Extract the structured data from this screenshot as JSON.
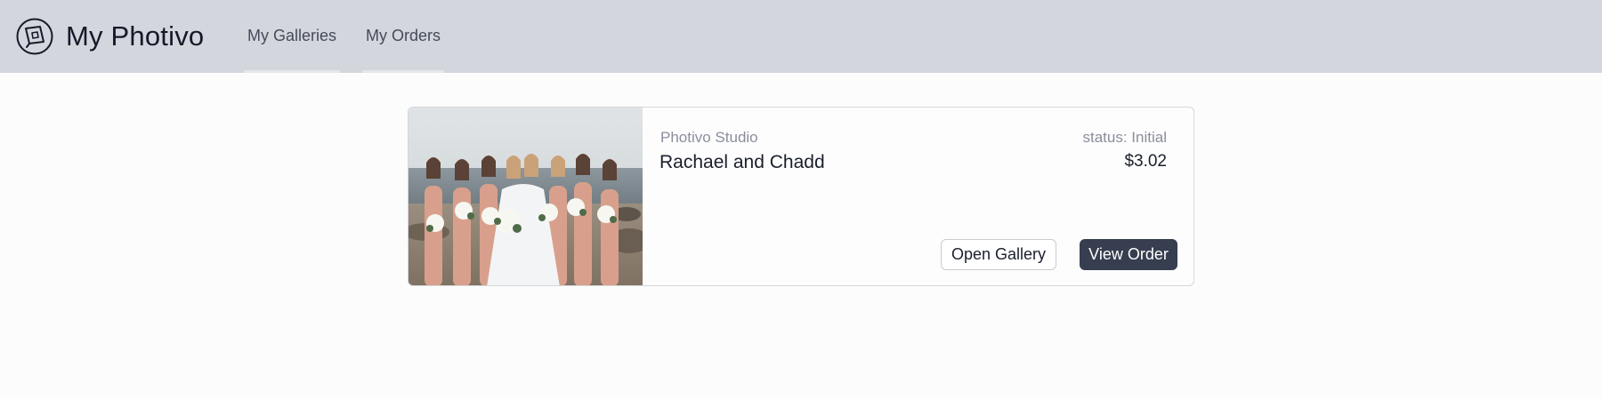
{
  "app": {
    "brand_name": "My Photivo",
    "logo_icon": "photivo-logo-icon"
  },
  "nav": {
    "tabs": [
      {
        "label": "My Galleries"
      },
      {
        "label": "My Orders"
      }
    ]
  },
  "order_card": {
    "image_icon": "bridal-party-photo",
    "studio": "Photivo Studio",
    "title": "Rachael and Chadd",
    "status": "status: Initial",
    "price": "$3.02",
    "open_gallery_label": "Open Gallery",
    "view_order_label": "View Order"
  },
  "colors": {
    "topbar": "#d3d6dd",
    "primary_button": "#363e4f",
    "muted_text": "#8a8f9b"
  }
}
